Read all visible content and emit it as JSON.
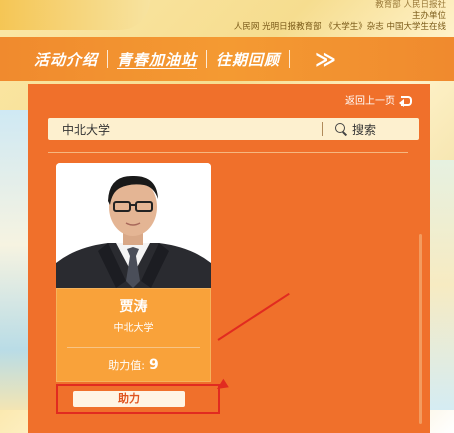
{
  "header": {
    "orgs_top": "教育部 人民日报社",
    "orgs_label": "主办单位",
    "orgs_list": "人民网  光明日报教育部  《大学生》杂志  中国大学生在线"
  },
  "nav": {
    "items": [
      "活动介绍",
      "青春加油站",
      "往期回顾"
    ],
    "active_index": 1,
    "more": "≫"
  },
  "back": {
    "label": "返回上一页"
  },
  "search": {
    "value": "中北大学",
    "button_label": "搜索"
  },
  "card": {
    "name": "贾涛",
    "school": "中北大学",
    "score_label": "助力值:",
    "score_value": "9",
    "boost_label": "助力"
  },
  "colors": {
    "panel": "#f0702b",
    "nav": "#f08a2e",
    "highlight": "#e12b20"
  }
}
